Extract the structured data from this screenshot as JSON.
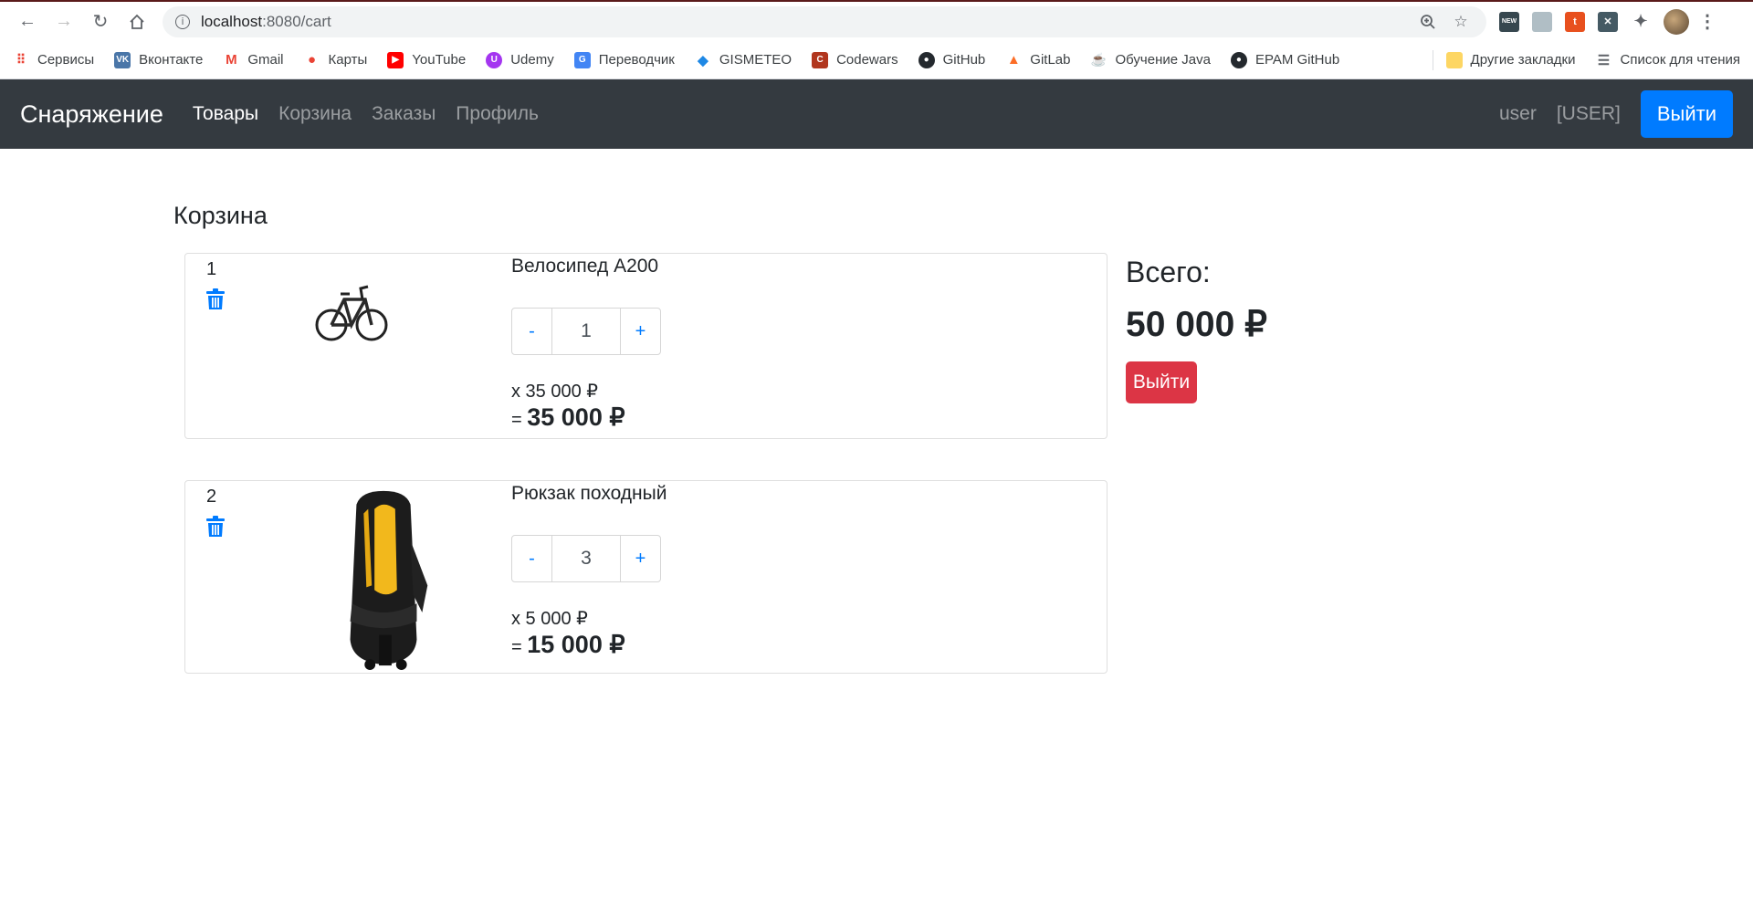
{
  "browser": {
    "url_host": "localhost",
    "url_path": ":8080/cart",
    "bookmarks": [
      {
        "label": "Сервисы",
        "color": "#4285f4",
        "glyph": "⋮⋮"
      },
      {
        "label": "Вконтакте",
        "color": "#4a76a8",
        "glyph": "VK"
      },
      {
        "label": "Gmail",
        "color": "#ea4335",
        "glyph": "M"
      },
      {
        "label": "Карты",
        "color": "#ea4335",
        "glyph": "●"
      },
      {
        "label": "YouTube",
        "color": "#ff0000",
        "glyph": "▶"
      },
      {
        "label": "Udemy",
        "color": "#a435f0",
        "glyph": "U"
      },
      {
        "label": "Переводчик",
        "color": "#4285f4",
        "glyph": "G"
      },
      {
        "label": "GISMETEO",
        "color": "#1e88e5",
        "glyph": "◆"
      },
      {
        "label": "Codewars",
        "color": "#b1361e",
        "glyph": "C"
      },
      {
        "label": "GitHub",
        "color": "#24292e",
        "glyph": "●"
      },
      {
        "label": "GitLab",
        "color": "#fc6d26",
        "glyph": "▲"
      },
      {
        "label": "Обучение Java",
        "color": "#333333",
        "glyph": "☕"
      },
      {
        "label": "EPAM GitHub",
        "color": "#24292e",
        "glyph": "●"
      }
    ],
    "other_bookmarks": "Другие закладки",
    "reading_list": "Список для чтения"
  },
  "navbar": {
    "brand": "Снаряжение",
    "links": [
      "Товары",
      "Корзина",
      "Заказы",
      "Профиль"
    ],
    "active_index": 0,
    "username": "user",
    "role": "[USER]",
    "logout_label": "Выйти"
  },
  "cart": {
    "title": "Корзина",
    "items": [
      {
        "index": "1",
        "name": "Велосипед A200",
        "quantity": "1",
        "unit_price": "x 35 000 ₽",
        "sum_prefix": "=",
        "sum": "35 000 ₽",
        "image": "bicycle"
      },
      {
        "index": "2",
        "name": "Рюкзак походный",
        "quantity": "3",
        "unit_price": "x 5 000 ₽",
        "sum_prefix": "=",
        "sum": "15 000 ₽",
        "image": "backpack"
      }
    ],
    "minus_label": "-",
    "plus_label": "+"
  },
  "summary": {
    "label": "Всего:",
    "total": "50 000 ₽",
    "button_label": "Выйти"
  }
}
